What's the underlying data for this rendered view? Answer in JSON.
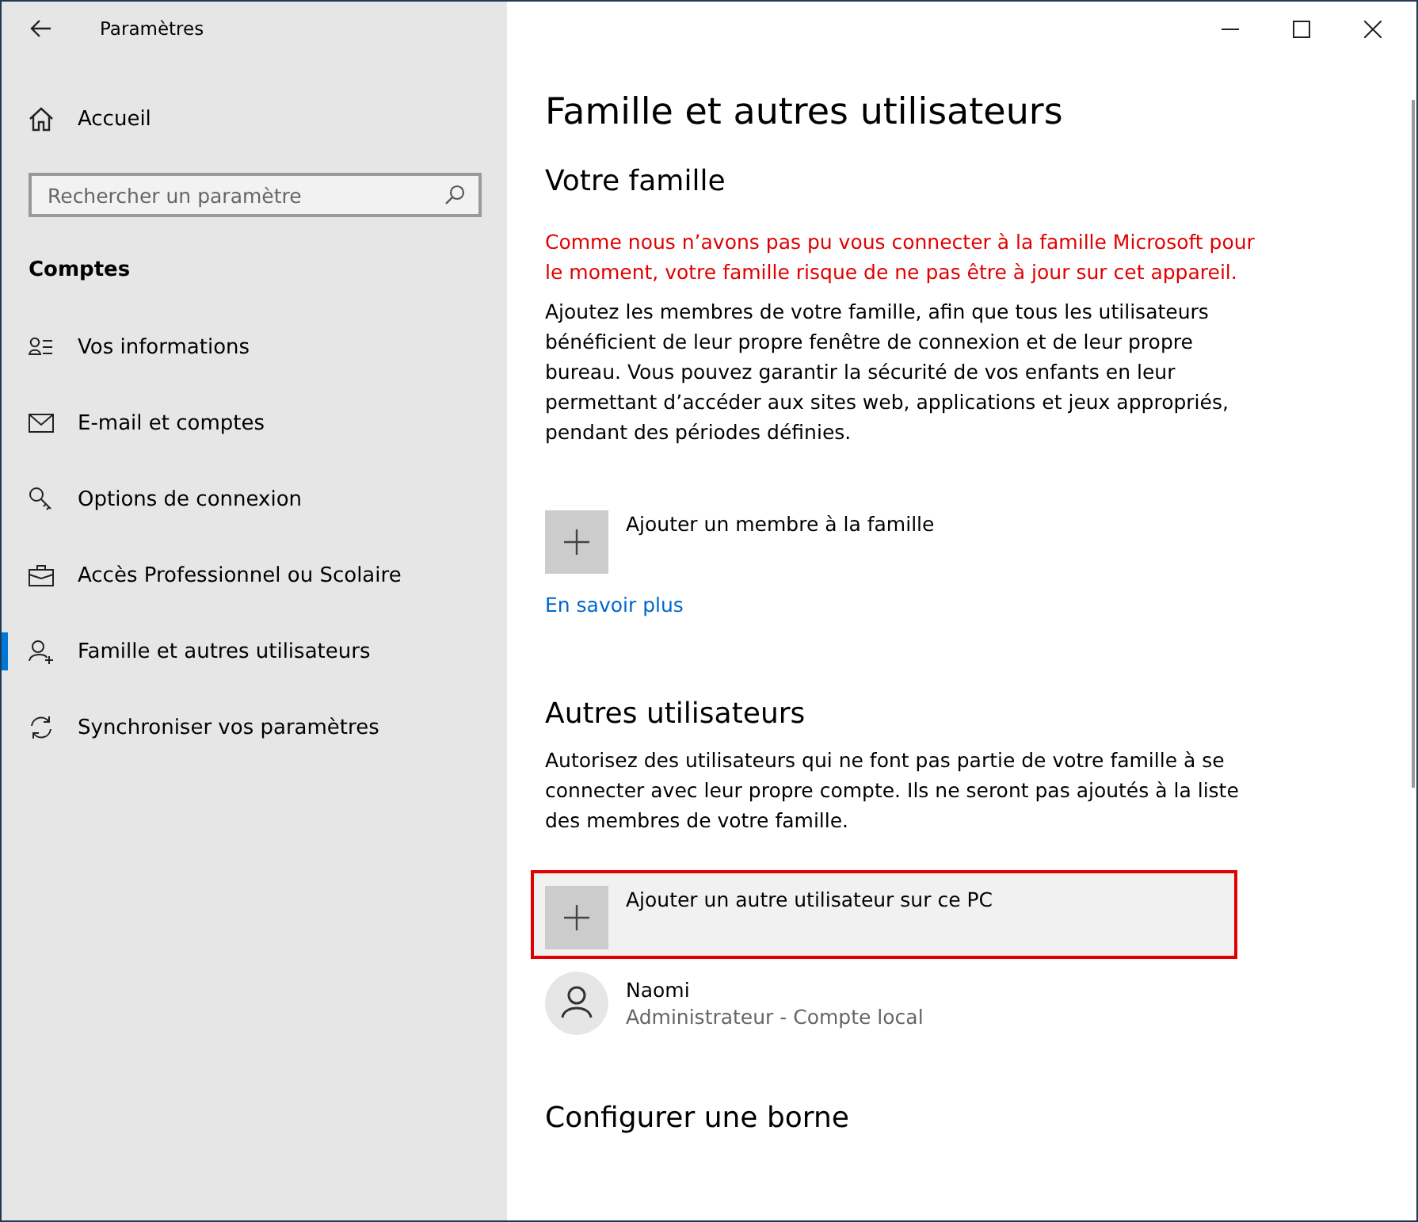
{
  "window": {
    "title": "Paramètres"
  },
  "sidebar": {
    "home": "Accueil",
    "search": {
      "placeholder": "Rechercher un paramètre"
    },
    "section": "Comptes",
    "items": [
      {
        "label": "Vos informations",
        "kind": "person-list",
        "selected": false
      },
      {
        "label": "E-mail et comptes",
        "kind": "mail",
        "selected": false
      },
      {
        "label": "Options de connexion",
        "kind": "key",
        "selected": false
      },
      {
        "label": "Accès Professionnel ou Scolaire",
        "kind": "briefcase",
        "selected": false
      },
      {
        "label": "Famille et autres utilisateurs",
        "kind": "person-add",
        "selected": true
      },
      {
        "label": "Synchroniser vos paramètres",
        "kind": "sync",
        "selected": false
      }
    ]
  },
  "main": {
    "title": "Famille et autres utilisateurs",
    "family": {
      "heading": "Votre famille",
      "warning": "Comme nous n’avons pas pu vous connecter à la famille Microsoft pour le moment, votre famille risque de ne pas être à jour sur cet appareil.",
      "description": "Ajoutez les membres de votre famille, afin que tous les utilisateurs bénéficient de leur propre fenêtre de connexion et de leur propre bureau. Vous pouvez garantir la sécurité de vos enfants en leur permettant d’accéder aux sites web, applications et jeux appropriés, pendant des périodes définies.",
      "add": {
        "label": "Ajouter un membre à la famille",
        "highlighted": false
      },
      "link": "En savoir plus"
    },
    "others": {
      "heading": "Autres utilisateurs",
      "description": "Autorisez des utilisateurs qui ne font pas partie de votre famille à se connecter avec leur propre compte. Ils ne seront pas ajoutés à la liste des membres de votre famille.",
      "add": {
        "label": "Ajouter un autre utilisateur sur ce PC",
        "highlighted": true
      },
      "users": [
        {
          "name": "Naomi",
          "detail": "Administrateur - Compte local"
        }
      ]
    },
    "kiosk": {
      "heading": "Configurer une borne"
    }
  }
}
